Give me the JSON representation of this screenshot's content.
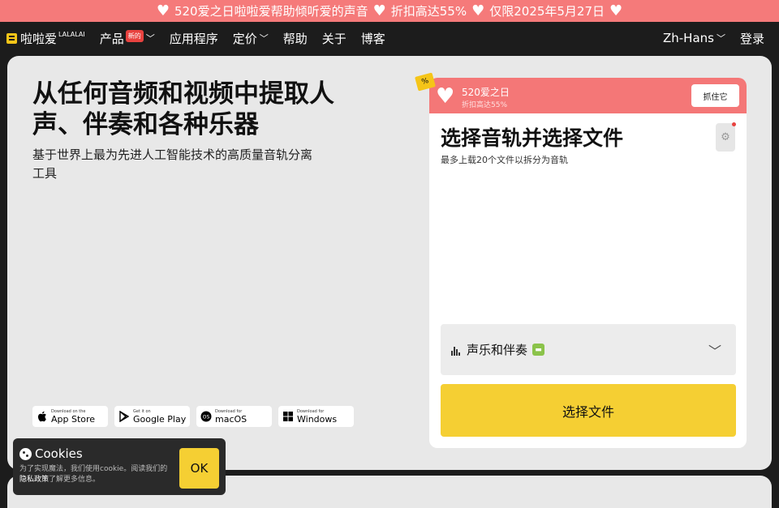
{
  "promo_banner": {
    "text": "520爱之日啦啦爱帮助倾听爱的声音",
    "discount": "折扣高达55%",
    "deadline": "仅限2025年5月27日"
  },
  "nav": {
    "logo": "啦啦爱",
    "logo_sub": "LALALAI",
    "items": [
      {
        "label": "产品",
        "badge": "新的",
        "dropdown": true
      },
      {
        "label": "应用程序"
      },
      {
        "label": "定价",
        "dropdown": true
      },
      {
        "label": "帮助"
      },
      {
        "label": "关于"
      },
      {
        "label": "博客"
      }
    ],
    "language": "Zh-Hans",
    "login": "登录"
  },
  "hero": {
    "title": "从任何音频和视频中提取人声、伴奏和各种乐器",
    "subtitle": "基于世界上最为先进人工智能技术的高质量音轨分离工具"
  },
  "stores": [
    {
      "small": "Download on the",
      "big": "App Store",
      "icon": "apple-icon"
    },
    {
      "small": "Get it on",
      "big": "Google Play",
      "icon": "play-icon"
    },
    {
      "small": "Download for",
      "big": "macOS",
      "icon": "macos-icon"
    },
    {
      "small": "Download for",
      "big": "Windows",
      "icon": "windows-icon"
    }
  ],
  "upload_card": {
    "tag": "%",
    "promo_title": "520爱之日",
    "promo_sub": "折扣高达55%",
    "grab_button": "抓住它",
    "title": "选择音轨并选择文件",
    "subtitle": "最多上载20个文件以拆分为音轨",
    "stem_option": "声乐和伴奏",
    "choose_button": "选择文件"
  },
  "cookie": {
    "title": "Cookies",
    "text_before": "为了实现魔法，我们使用cookie。阅读我们的",
    "link": "隐私政策",
    "text_after": "了解更多信息。",
    "ok": "OK"
  },
  "colors": {
    "promo_bg": "#f57a7a",
    "accent_yellow": "#f5cf33",
    "dark_bg": "#1c1c1c",
    "panel_bg": "#e8e8e8"
  }
}
